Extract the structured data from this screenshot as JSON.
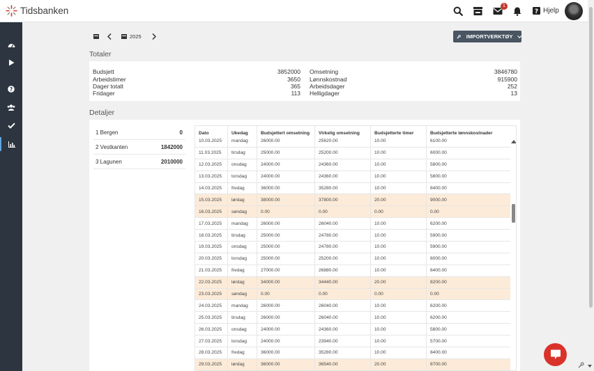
{
  "app": {
    "name": "Tidsbanken",
    "help_label": "Hjelp",
    "mail_badge": "1"
  },
  "toolbar": {
    "year": "2025",
    "import_label": "IMPORTVERKTØY"
  },
  "totals": {
    "title": "Totaler",
    "left": [
      {
        "label": "Budsjett",
        "value": "3852000"
      },
      {
        "label": "Arbeidstimer",
        "value": "3650"
      },
      {
        "label": "Dager totalt",
        "value": "365"
      },
      {
        "label": "Fridager",
        "value": "113"
      }
    ],
    "right": [
      {
        "label": "Omsetning",
        "value": "3846780"
      },
      {
        "label": "Lønnskostnad",
        "value": "915900"
      },
      {
        "label": "Arbeidsdager",
        "value": "252"
      },
      {
        "label": "Helligdager",
        "value": "13"
      }
    ]
  },
  "details": {
    "title": "Detaljer",
    "departments": [
      {
        "name": "1 Bergen",
        "amount": "0"
      },
      {
        "name": "2 Vestkanten",
        "amount": "1842000"
      },
      {
        "name": "3 Lagunen",
        "amount": "2010000"
      }
    ],
    "columns": [
      "Dato",
      "Ukedag",
      "Budsjettert omsetning",
      "Virkelig omsetning",
      "Budsjetterte timer",
      "Budsjetterte lønnskostnader"
    ],
    "rows": [
      {
        "date": "10.03.2025",
        "day": "mandag",
        "budget": "26000.00",
        "actual": "25620.00",
        "hours": "10.00",
        "wages": "6100.00",
        "weekend": false
      },
      {
        "date": "11.03.2025",
        "day": "tirsdag",
        "budget": "25000.00",
        "actual": "25200.00",
        "hours": "10.00",
        "wages": "6000.00",
        "weekend": false
      },
      {
        "date": "12.03.2025",
        "day": "onsdag",
        "budget": "24000.00",
        "actual": "24360.00",
        "hours": "10.00",
        "wages": "5800.00",
        "weekend": false
      },
      {
        "date": "13.03.2025",
        "day": "torsdag",
        "budget": "24000.00",
        "actual": "24360.00",
        "hours": "10.00",
        "wages": "5800.00",
        "weekend": false
      },
      {
        "date": "14.03.2025",
        "day": "fredag",
        "budget": "36000.00",
        "actual": "35280.00",
        "hours": "10.00",
        "wages": "8400.00",
        "weekend": false
      },
      {
        "date": "15.03.2025",
        "day": "lørdag",
        "budget": "38000.00",
        "actual": "37800.00",
        "hours": "20.00",
        "wages": "9000.00",
        "weekend": true
      },
      {
        "date": "16.03.2025",
        "day": "søndag",
        "budget": "0.00",
        "actual": "0.00",
        "hours": "0.00",
        "wages": "0.00",
        "weekend": true
      },
      {
        "date": "17.03.2025",
        "day": "mandag",
        "budget": "26000.00",
        "actual": "26040.00",
        "hours": "10.00",
        "wages": "6200.00",
        "weekend": false
      },
      {
        "date": "18.03.2025",
        "day": "tirsdag",
        "budget": "25000.00",
        "actual": "24780.00",
        "hours": "10.00",
        "wages": "5900.00",
        "weekend": false
      },
      {
        "date": "19.03.2025",
        "day": "onsdag",
        "budget": "25000.00",
        "actual": "24780.00",
        "hours": "10.00",
        "wages": "5900.00",
        "weekend": false
      },
      {
        "date": "20.03.2025",
        "day": "torsdag",
        "budget": "25000.00",
        "actual": "25200.00",
        "hours": "10.00",
        "wages": "6000.00",
        "weekend": false
      },
      {
        "date": "21.03.2025",
        "day": "fredag",
        "budget": "27000.00",
        "actual": "26880.00",
        "hours": "10.00",
        "wages": "6400.00",
        "weekend": false
      },
      {
        "date": "22.03.2025",
        "day": "lørdag",
        "budget": "34000.00",
        "actual": "34440.00",
        "hours": "20.00",
        "wages": "8200.00",
        "weekend": true
      },
      {
        "date": "23.03.2025",
        "day": "søndag",
        "budget": "0.00",
        "actual": "0.00",
        "hours": "0.00",
        "wages": "0.00",
        "weekend": true
      },
      {
        "date": "24.03.2025",
        "day": "mandag",
        "budget": "26000.00",
        "actual": "26040.00",
        "hours": "10.00",
        "wages": "6200.00",
        "weekend": false
      },
      {
        "date": "25.03.2025",
        "day": "tirsdag",
        "budget": "26000.00",
        "actual": "26040.00",
        "hours": "10.00",
        "wages": "6200.00",
        "weekend": false
      },
      {
        "date": "26.03.2025",
        "day": "onsdag",
        "budget": "24000.00",
        "actual": "24360.00",
        "hours": "10.00",
        "wages": "5800.00",
        "weekend": false
      },
      {
        "date": "27.03.2025",
        "day": "torsdag",
        "budget": "24000.00",
        "actual": "23940.00",
        "hours": "10.00",
        "wages": "5700.00",
        "weekend": false
      },
      {
        "date": "28.03.2025",
        "day": "fredag",
        "budget": "36000.00",
        "actual": "35280.00",
        "hours": "10.00",
        "wages": "8400.00",
        "weekend": false
      },
      {
        "date": "29.03.2025",
        "day": "lørdag",
        "budget": "36000.00",
        "actual": "36540.00",
        "hours": "20.00",
        "wages": "8700.00",
        "weekend": true
      }
    ]
  },
  "colors": {
    "sidebar": "#2c3540",
    "accent": "#5fa7d9",
    "weekend_row": "#fcebd8",
    "chat": "#d9322b",
    "logo_red": "#d9322b"
  }
}
